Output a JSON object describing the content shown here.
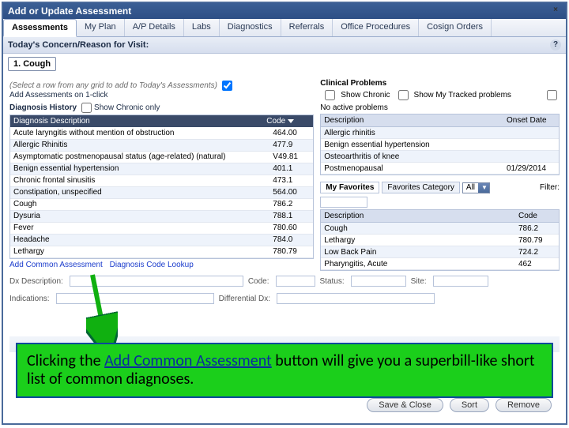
{
  "window": {
    "title": "Add or Update Assessment",
    "close": "×"
  },
  "tabs": [
    "Assessments",
    "My Plan",
    "A/P Details",
    "Labs",
    "Diagnostics",
    "Referrals",
    "Office Procedures",
    "Cosign Orders"
  ],
  "active_tab": 0,
  "concern": {
    "header": "Today's Concern/Reason for Visit:",
    "value": "1. Cough"
  },
  "left": {
    "hint": "(Select a row from any grid to add to Today's Assessments)",
    "add_on_1click": "Add Assessments on 1-click",
    "history_label": "Diagnosis History",
    "show_chronic": "Show Chronic only",
    "cols": {
      "desc": "Diagnosis Description",
      "code": "Code"
    },
    "rows": [
      {
        "desc": "Acute laryngitis without mention of obstruction",
        "code": "464.00"
      },
      {
        "desc": "Allergic Rhinitis",
        "code": "477.9"
      },
      {
        "desc": "Asymptomatic postmenopausal status (age-related) (natural)",
        "code": "V49.81"
      },
      {
        "desc": "Benign essential hypertension",
        "code": "401.1"
      },
      {
        "desc": "Chronic frontal sinusitis",
        "code": "473.1"
      },
      {
        "desc": "Constipation, unspecified",
        "code": "564.00"
      },
      {
        "desc": "Cough",
        "code": "786.2"
      },
      {
        "desc": "Dysuria",
        "code": "788.1"
      },
      {
        "desc": "Fever",
        "code": "780.60"
      },
      {
        "desc": "Headache",
        "code": "784.0"
      },
      {
        "desc": "Lethargy",
        "code": "780.79"
      }
    ],
    "links": {
      "add_common": "Add Common Assessment",
      "code_lookup": "Diagnosis Code Lookup"
    },
    "fields": {
      "dx_desc": "Dx Description:",
      "code": "Code:",
      "status": "Status:",
      "site": "Site:",
      "indications": "Indications:",
      "diff_dx": "Differential Dx:"
    }
  },
  "right": {
    "clinprob": "Clinical Problems",
    "show_chronic": "Show Chronic",
    "show_tracked": "Show My Tracked problems",
    "no_active": "No active problems",
    "cols": {
      "desc": "Description",
      "onset": "Onset Date"
    },
    "rows": [
      {
        "desc": "Allergic rhinitis",
        "onset": ""
      },
      {
        "desc": "Benign essential hypertension",
        "onset": ""
      },
      {
        "desc": "Osteoarthritis of knee",
        "onset": ""
      },
      {
        "desc": "Postmenopausal",
        "onset": "01/29/2014"
      }
    ],
    "fav_tabs": [
      "My Favorites",
      "Favorites Category"
    ],
    "fav_cat": "All",
    "filter": "Filter:",
    "fav_cols": {
      "desc": "Description",
      "code": "Code"
    },
    "fav_rows": [
      {
        "desc": "Cough",
        "code": "786.2"
      },
      {
        "desc": "Lethargy",
        "code": "780.79"
      },
      {
        "desc": "Low Back Pain",
        "code": "724.2"
      },
      {
        "desc": "Pharyngitis, Acute",
        "code": "462"
      }
    ]
  },
  "footer": {
    "save": "Save & Close",
    "sort": "Sort",
    "remove": "Remove"
  },
  "callout": {
    "pre": "Clicking the ",
    "link": "Add Common Assessment",
    "post": " button will give you a superbill-like short list of common diagnoses."
  }
}
